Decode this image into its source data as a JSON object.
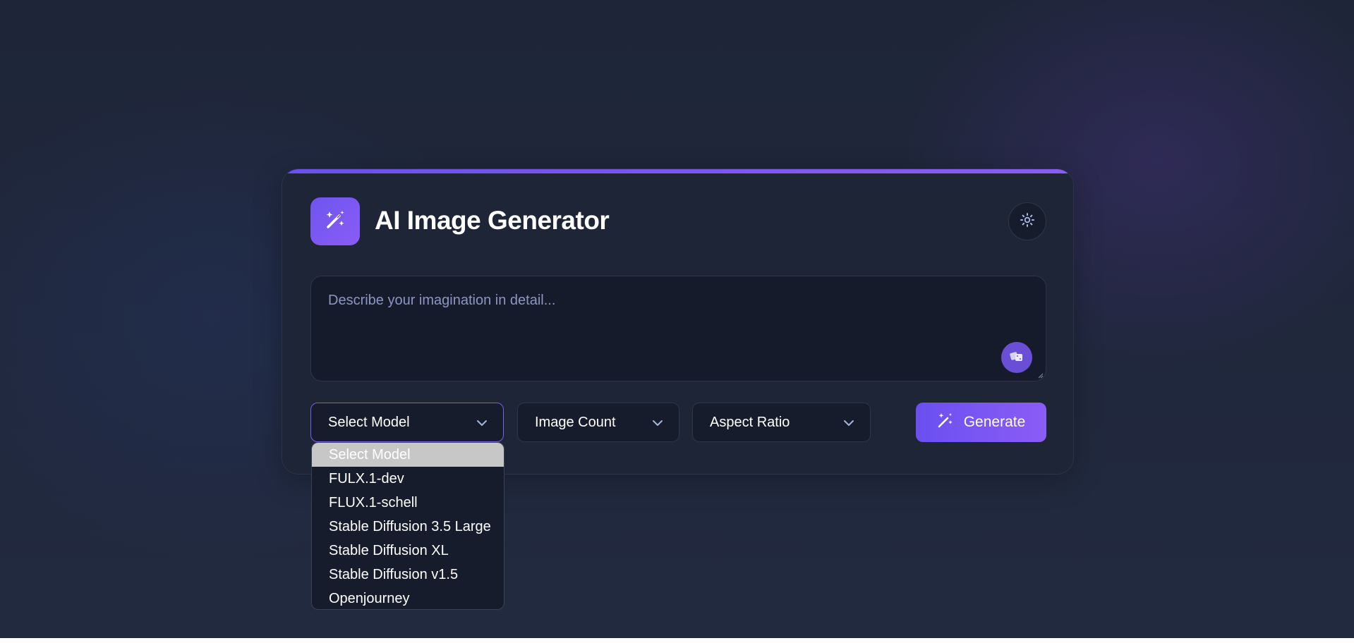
{
  "app": {
    "title": "AI Image Generator"
  },
  "prompt": {
    "placeholder": "Describe your imagination in detail...",
    "value": ""
  },
  "controls": {
    "model_select": {
      "label": "Select Model"
    },
    "count_select": {
      "label": "Image Count"
    },
    "ratio_select": {
      "label": "Aspect Ratio"
    },
    "generate_label": "Generate"
  },
  "model_dropdown": {
    "items": [
      "Select Model",
      "FULX.1-dev",
      "FLUX.1-schell",
      "Stable Diffusion 3.5 Large",
      "Stable Diffusion XL",
      "Stable Diffusion v1.5",
      "Openjourney"
    ],
    "selected_index": 0
  },
  "icons": {
    "logo": "magic-wand-sparkles-icon",
    "theme_toggle": "sun-icon",
    "random_prompt": "dice-icon",
    "generate": "magic-wand-icon",
    "select_arrow": "chevron-down-icon"
  },
  "colors": {
    "accent": "#7c5cf5",
    "card_background": "#1e2536",
    "page_background": "#1f2538",
    "input_background": "#151b2a"
  }
}
